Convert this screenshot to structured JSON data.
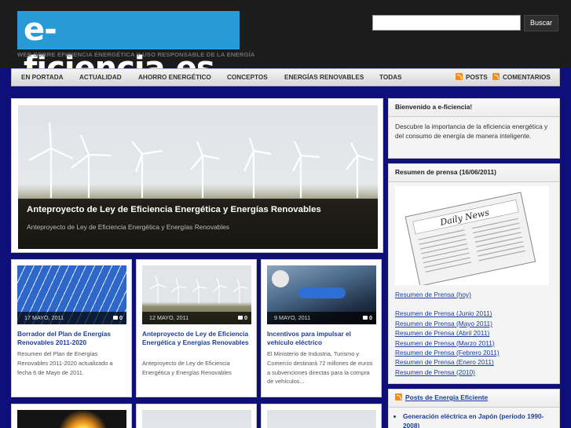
{
  "header": {
    "logo": "e-ficiencia.es",
    "tagline": "WEB SOBRE EFICIENCIA ENERGÉTICA Y USO RESPONSABLE DE LA ENERGÍA",
    "search_placeholder": "",
    "search_button": "Buscar"
  },
  "nav": {
    "items": [
      "EN PORTADA",
      "ACTUALIDAD",
      "AHORRO ENERGÉTICO",
      "CONCEPTOS",
      "ENERGÍAS RENOVABLES",
      "TODAS"
    ],
    "posts": "POSTS",
    "comments": "COMENTARIOS"
  },
  "featured": {
    "title": "Anteproyecto de Ley de Eficiencia Energética y Energías Renovables",
    "subtitle": "Anteproyecto de Ley de Eficiencia Energética y Energías Renovables"
  },
  "cards": [
    {
      "date": "17 MAYO, 2011",
      "comments": "0",
      "title": "Borrador del Plan de Energías Renovables 2011-2020",
      "text": "Resumen del Plan de Energías Renovables 2011-2020 actualizado a fecha 6 de Mayo de 2011."
    },
    {
      "date": "12 MAYO, 2011",
      "comments": "0",
      "title": "Anteproyecto de Ley de Eficiencia Energética y Energías Renovables",
      "text": "Anteproyecto de Ley de Eficiencia Energética y Energías Renovables"
    },
    {
      "date": "9 MAYO, 2011",
      "comments": "0",
      "title": "Incentivos para impulsar el vehículo eléctrico",
      "text": "El Ministerio de Industria, Turismo y Comercio destinará 72 millones de euros a subvenciones directas para la compra de vehículos..."
    }
  ],
  "sidebar": {
    "welcome": {
      "title": "Bienvenido a e-ficiencia!",
      "text": "Descubre la importancia de la eficiencia energética y del consumo de energía de manera inteligente."
    },
    "press": {
      "title": "Resumen de prensa (16/06/2011)",
      "newspaper_name": "Daily News",
      "links": [
        "Resumen de Prensa (hoy)",
        "Resumen de Prensa (Junio 2011)",
        "Resumen de Prensa (Mayo 2011)",
        "Resumen de Prensa (Abril 2011)",
        "Resumen de Prensa (Marzo 2011)",
        "Resumen de Prensa (Febrero 2011)",
        "Resumen de Prensa (Enero 2011)",
        "Resumen de Prensa (2010)"
      ]
    },
    "posts": {
      "title": "Posts de Energía Eficiente",
      "items": [
        "Generación eléctrica en Japón (período 1990-2008)"
      ]
    }
  },
  "colors": {
    "page_bg": "#0f0f7a",
    "header_bg": "#1c1c1c",
    "logo_bg": "#2a9ad6",
    "link": "#1d3f9c",
    "rss": "#f58a1f"
  }
}
